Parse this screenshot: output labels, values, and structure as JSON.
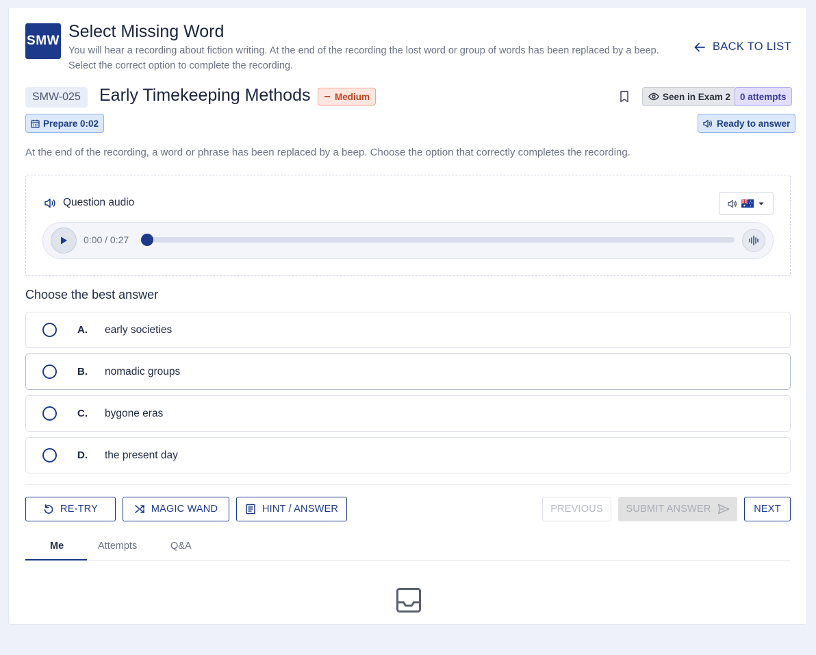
{
  "header": {
    "logo_text": "SMW",
    "title": "Select Missing Word",
    "subtitle": "You will hear a recording about fiction writing. At the end of the recording the lost word or group of words has been replaced by a beep. Select the correct option to complete the recording.",
    "back_label": "BACK TO LIST"
  },
  "question": {
    "code": "SMW-025",
    "title": "Early Timekeeping Methods",
    "difficulty": "Medium",
    "seen_label": "Seen in Exam 2",
    "attempts_label": "0 attempts",
    "prepare_label": "Prepare 0:02",
    "status_label": "Ready to answer",
    "instruction": "At the end of the recording, a word or phrase has been replaced by a beep. Choose the option that correctly completes the recording."
  },
  "audio": {
    "label": "Question audio",
    "time": "0:00 / 0:27",
    "progress": 0,
    "accent_flag": "🇦🇺"
  },
  "answers": {
    "heading": "Choose the best answer",
    "options": [
      {
        "letter": "A.",
        "text": "early societies"
      },
      {
        "letter": "B.",
        "text": "nomadic groups"
      },
      {
        "letter": "C.",
        "text": "bygone eras"
      },
      {
        "letter": "D.",
        "text": "the present day"
      }
    ]
  },
  "actions": {
    "retry": "RE-TRY",
    "magic_wand": "MAGIC WAND",
    "hint": "HINT / ANSWER",
    "previous": "PREVIOUS",
    "submit": "SUBMIT ANSWER",
    "next": "NEXT"
  },
  "tabs": [
    {
      "label": "Me",
      "active": true
    },
    {
      "label": "Attempts",
      "active": false
    },
    {
      "label": "Q&A",
      "active": false
    }
  ],
  "colors": {
    "primary": "#1d3a8a",
    "difficulty_bg": "#fde6df",
    "difficulty_text": "#c0441e",
    "attempts_bg": "#e0defc",
    "status_bg": "#dce8fb"
  }
}
